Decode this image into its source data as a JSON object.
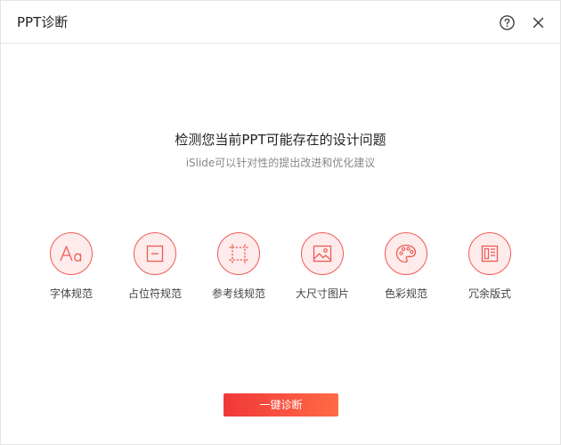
{
  "window": {
    "title": "PPT诊断"
  },
  "header": {
    "help_icon": "question-circle-icon",
    "close_icon": "close-x-icon"
  },
  "main": {
    "headline": "检测您当前PPT可能存在的设计问题",
    "subheadline": "iSlide可以针对性的提出改进和优化建议"
  },
  "features": [
    {
      "label": "字体规范",
      "icon": "font-aa-icon"
    },
    {
      "label": "占位符规范",
      "icon": "placeholder-icon"
    },
    {
      "label": "参考线规范",
      "icon": "guides-icon"
    },
    {
      "label": "大尺寸图片",
      "icon": "image-icon"
    },
    {
      "label": "色彩规范",
      "icon": "palette-icon"
    },
    {
      "label": "冗余版式",
      "icon": "layout-icon"
    }
  ],
  "actions": {
    "diagnose_label": "一键诊断"
  },
  "colors": {
    "accent": "#ef5a55",
    "icon_bg": "#fdeceb",
    "button_gradient_start": "#f0383a",
    "button_gradient_end": "#ff6a45"
  }
}
